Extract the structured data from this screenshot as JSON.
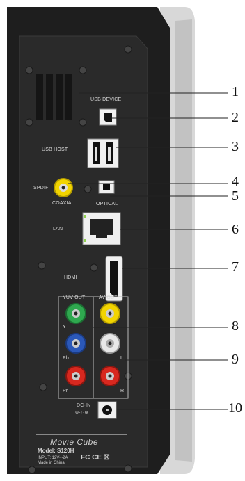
{
  "labels": {
    "usb_device": "USB DEVICE",
    "usb_host": "USB HOST",
    "spdif": "SPDIF",
    "coaxial": "COAXIAL",
    "optical": "OPTICAL",
    "lan": "LAN",
    "hdmi": "HDMI",
    "yuv_out": "YUV OUT",
    "av_out": "AV OUT",
    "y": "Y",
    "pb": "Pb",
    "pr": "Pr",
    "l": "L",
    "r": "R",
    "dc_in": "DC-IN",
    "dc_symbol": "⊖-◐-⊕"
  },
  "brand": "Movie Cube",
  "specs": {
    "model": "Model: S120H",
    "input": "INPUT: 12V⎓2A",
    "origin": "Made in China"
  },
  "marks": "FC CE ☒",
  "callouts": [
    "1",
    "2",
    "3",
    "4",
    "5",
    "6",
    "7",
    "8",
    "9",
    "10"
  ],
  "colors": {
    "body": "#1f1f1f",
    "panel": "#2b2b2b",
    "frame": "#d9d9d9",
    "yellow": "#f2d400",
    "green": "#2fa84f",
    "blue": "#2b58b8",
    "red": "#d8281f",
    "white": "#e8e8e8"
  }
}
